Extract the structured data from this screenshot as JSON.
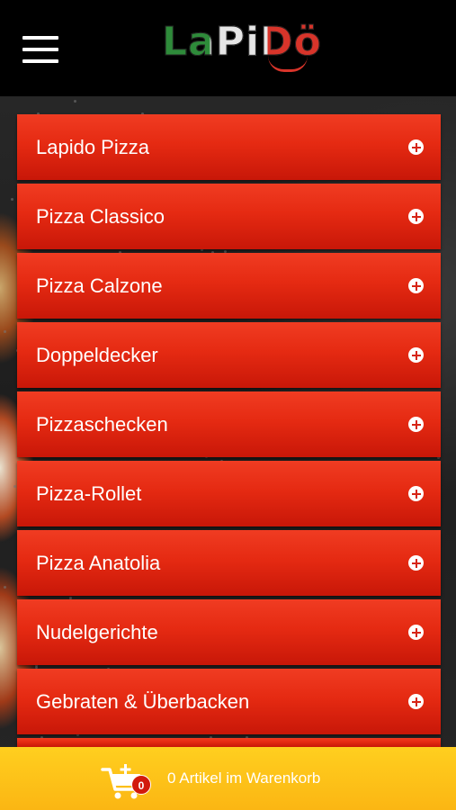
{
  "header": {
    "logo_text": "LaPiDö",
    "menu_icon": "hamburger-icon"
  },
  "categories": [
    {
      "label": "Lapido Pizza",
      "icon": "plus-circle-icon"
    },
    {
      "label": "Pizza Classico",
      "icon": "plus-circle-icon"
    },
    {
      "label": "Pizza Calzone",
      "icon": "plus-circle-icon"
    },
    {
      "label": "Doppeldecker",
      "icon": "plus-circle-icon"
    },
    {
      "label": "Pizzaschecken",
      "icon": "plus-circle-icon"
    },
    {
      "label": "Pizza-Rollet",
      "icon": "plus-circle-icon"
    },
    {
      "label": "Pizza Anatolia",
      "icon": "plus-circle-icon"
    },
    {
      "label": "Nudelgerichte",
      "icon": "plus-circle-icon"
    },
    {
      "label": "Gebraten & Überbacken",
      "icon": "plus-circle-icon"
    }
  ],
  "cart": {
    "count": "0",
    "label": "0 Artikel im Warenkorb",
    "icon": "cart-add-icon"
  },
  "colors": {
    "header_bg": "#000000",
    "item_red": "#e52a12",
    "cart_yellow": "#fbb613",
    "badge_red": "#d21a0c"
  }
}
